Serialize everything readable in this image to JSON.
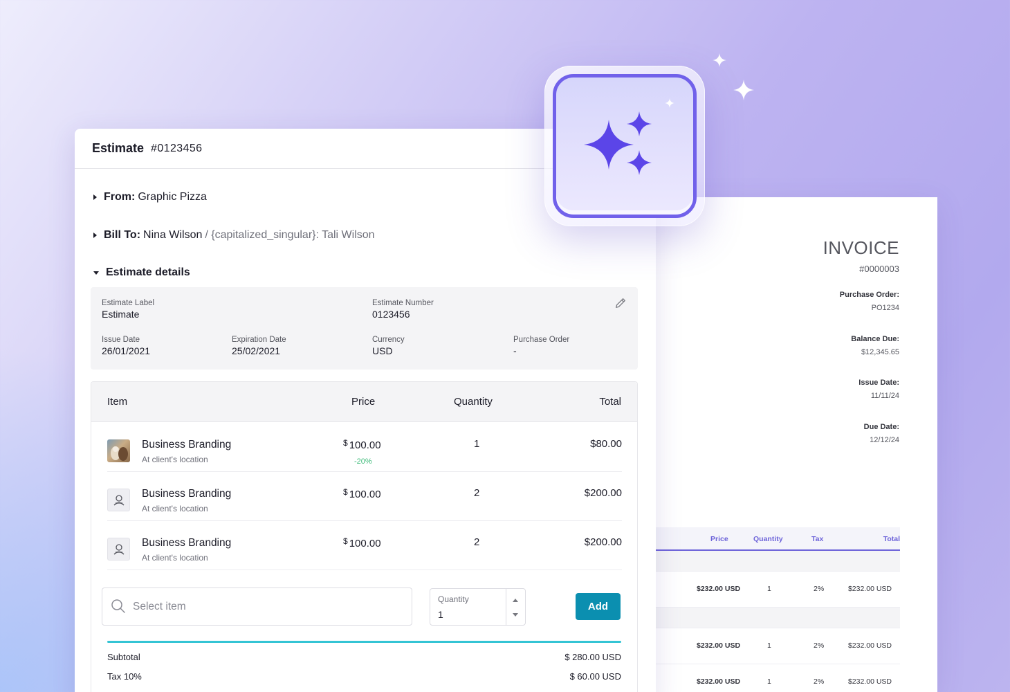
{
  "estimate": {
    "title": "Estimate",
    "number": "#0123456",
    "from_label": "From:",
    "from_value": "Graphic Pizza",
    "bill_label": "Bill To:",
    "bill_value": "Nina Wilson",
    "bill_extra": "/ {capitalized_singular}: Tali Wilson",
    "details_label": "Estimate details",
    "details": {
      "estimate_label_key": "Estimate Label",
      "estimate_label_value": "Estimate",
      "estimate_number_key": "Estimate Number",
      "estimate_number_value": "0123456",
      "issue_date_key": "Issue Date",
      "issue_date_value": "26/01/2021",
      "expiration_date_key": "Expiration Date",
      "expiration_date_value": "25/02/2021",
      "currency_key": "Currency",
      "currency_value": "USD",
      "purchase_order_key": "Purchase Order",
      "purchase_order_value": "-"
    },
    "table": {
      "headers": [
        "Item",
        "Price",
        "Quantity",
        "Total"
      ],
      "rows": [
        {
          "name": "Business Branding",
          "sub": "At client's location",
          "currency": "$",
          "price": "100.00",
          "discount": "-20%",
          "qty": "1",
          "total": "$80.00"
        },
        {
          "name": "Business Branding",
          "sub": "At client's location",
          "currency": "$",
          "price": "100.00",
          "qty": "2",
          "total": "$200.00"
        },
        {
          "name": "Business Branding",
          "sub": "At client's location",
          "currency": "$",
          "price": "100.00",
          "qty": "2",
          "total": "$200.00"
        }
      ]
    },
    "select_placeholder": "Select item",
    "qty_label": "Quantity",
    "qty_value": "1",
    "add_label": "Add",
    "subtotal_label": "Subtotal",
    "subtotal_value": "$ 280.00 USD",
    "tax_label": "Tax 10%",
    "tax_value": "$ 60.00 USD"
  },
  "invoice": {
    "title": "INVOICE",
    "number": "#0000003",
    "purchase_order_label": "Purchase Order:",
    "purchase_order_value": "PO1234",
    "balance_due_label": "Balance Due:",
    "balance_due_value": "$12,345.65",
    "issue_date_label": "Issue Date:",
    "issue_date_value": "11/11/24",
    "due_date_label": "Due Date:",
    "due_date_value": "12/12/24",
    "table_headers": [
      "Price",
      "Quantity",
      "Tax",
      "Total"
    ],
    "rows": [
      {
        "price": "$232.00 USD",
        "qty": "1",
        "tax": "2%",
        "total": "$232.00 USD"
      },
      {
        "price": "$232.00 USD",
        "qty": "1",
        "tax": "2%",
        "total": "$232.00 USD"
      },
      {
        "price": "$232.00 USD",
        "qty": "1",
        "tax": "2%",
        "total": "$232.00 USD"
      }
    ]
  },
  "icons": {
    "app_icon": "sparkles-icon",
    "edit": "pencil-icon",
    "search": "search-icon",
    "item_placeholder": "service-icon"
  },
  "colors": {
    "accent": "#7161ea",
    "add_button": "#0b8fb0",
    "discount": "#3dbb79",
    "progress": "#34c4d4",
    "invoice_accent": "#6d63d9"
  }
}
